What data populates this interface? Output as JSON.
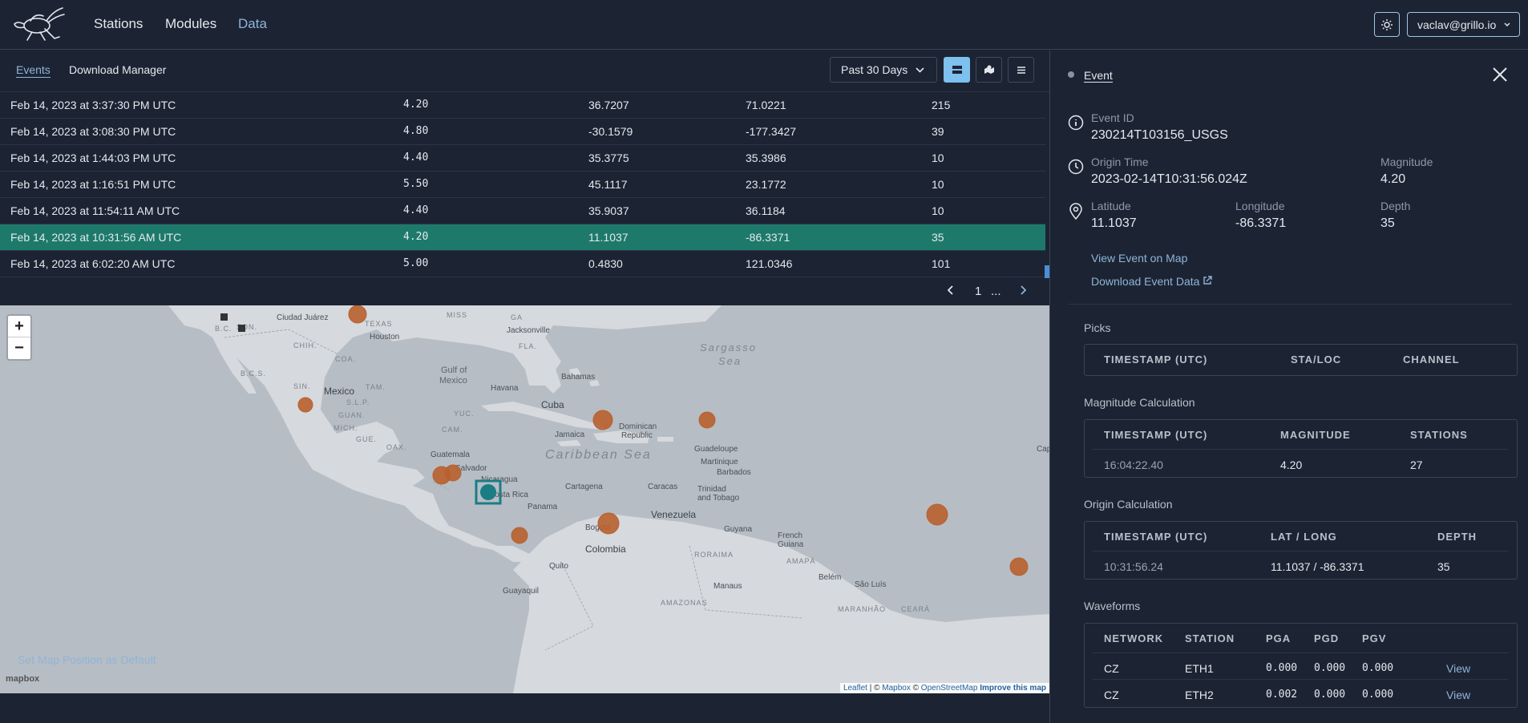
{
  "nav": {
    "items": [
      "Stations",
      "Modules",
      "Data"
    ],
    "active": "Data",
    "user": "vaclav@grillo.io"
  },
  "tabs": [
    "Events",
    "Download Manager"
  ],
  "period_select": "Past 30 Days",
  "events": [
    {
      "time": "Feb 14, 2023 at 3:37:30 PM UTC",
      "mag": "4.20",
      "lat": "36.7207",
      "lon": "71.0221",
      "depth": "215"
    },
    {
      "time": "Feb 14, 2023 at 3:08:30 PM UTC",
      "mag": "4.80",
      "lat": "-30.1579",
      "lon": "-177.3427",
      "depth": "39"
    },
    {
      "time": "Feb 14, 2023 at 1:44:03 PM UTC",
      "mag": "4.40",
      "lat": "35.3775",
      "lon": "35.3986",
      "depth": "10"
    },
    {
      "time": "Feb 14, 2023 at 1:16:51 PM UTC",
      "mag": "5.50",
      "lat": "45.1117",
      "lon": "23.1772",
      "depth": "10"
    },
    {
      "time": "Feb 14, 2023 at 11:54:11 AM UTC",
      "mag": "4.40",
      "lat": "35.9037",
      "lon": "36.1184",
      "depth": "10"
    },
    {
      "time": "Feb 14, 2023 at 10:31:56 AM UTC",
      "mag": "4.20",
      "lat": "11.1037",
      "lon": "-86.3371",
      "depth": "35"
    },
    {
      "time": "Feb 14, 2023 at 6:02:20 AM UTC",
      "mag": "5.00",
      "lat": "0.4830",
      "lon": "121.0346",
      "depth": "101"
    }
  ],
  "pager": {
    "page": "1",
    "ellipsis": "..."
  },
  "map": {
    "labels": {
      "ciudad_juarez": "Ciudad Juárez",
      "texas": "TEXAS",
      "miss": "MISS",
      "ga": "GA",
      "jacksonville": "Jacksonville",
      "fla": "FLA.",
      "houston": "Houston",
      "son": "SON.",
      "chih": "CHIH.",
      "coa": "COA.",
      "bcs": "B.C.S.",
      "bc": "B.C.",
      "sin": "SIN.",
      "tam": "TAM.",
      "mexico": "Mexico",
      "slp": "S.L.P.",
      "guan": "GUAN.",
      "mich": "MICH.",
      "gue": "GUE.",
      "oax": "OAX.",
      "yuc": "YUC.",
      "cam": "CAM.",
      "gulf": "Gulf of",
      "gulf2": "Mexico",
      "havana": "Havana",
      "cuba": "Cuba",
      "bahamas": "Bahamas",
      "sargasso": "Sargasso",
      "sea": "Sea",
      "jamaica": "Jamaica",
      "dominican": "Dominican",
      "republic": "Republic",
      "guatemala": "Guatemala",
      "salvador": "Salvador",
      "nicaragua": "Nicaragua",
      "costa_rica": "Costa Rica",
      "caribbean": "Caribbean Sea",
      "guadeloupe": "Guadeloupe",
      "martinique": "Martinique",
      "barbados": "Barbados",
      "cartagena": "Cartagena",
      "caracas": "Caracas",
      "trinidad": "Trinidad",
      "tobago": "and Tobago",
      "panama": "Panama",
      "venezuela": "Venezuela",
      "bogota": "Bogotá",
      "colombia": "Colombia",
      "guyana": "Guyana",
      "french": "French",
      "guiana": "Guiana",
      "roraima": "RORAIMA",
      "amapa": "AMAPÁ",
      "quito": "Quito",
      "belem": "Belém",
      "sao_luis": "São Luís",
      "manaus": "Manaus",
      "amazonas": "AMAZONAS",
      "guayaquil": "Guayaquil",
      "maranhao": "MARANHÃO",
      "ceara": "CEARÁ",
      "cap": "Cap"
    },
    "zoom_in": "+",
    "zoom_out": "−",
    "mapbox_logo": "mapbox",
    "attribution": {
      "leaflet": "Leaflet",
      "sep1": " | © ",
      "mapbox": "Mapbox",
      "sep2": " © ",
      "osm": "OpenStreetMap",
      "improve": "Improve this map"
    },
    "set_default": "Set Map Position as Default"
  },
  "detail": {
    "tab": "Event",
    "event_id_label": "Event ID",
    "event_id": "230214T103156_USGS",
    "origin_label": "Origin Time",
    "origin": "2023-02-14T10:31:56.024Z",
    "magnitude_label": "Magnitude",
    "magnitude": "4.20",
    "lat_label": "Latitude",
    "lat": "11.1037",
    "lon_label": "Longitude",
    "lon": "-86.3371",
    "depth_label": "Depth",
    "depth": "35",
    "view_on_map": "View Event on Map",
    "download": "Download Event Data",
    "picks_title": "Picks",
    "picks_headers": [
      "TIMESTAMP (UTC)",
      "STA/LOC",
      "CHANNEL"
    ],
    "mag_title": "Magnitude Calculation",
    "mag_headers": [
      "TIMESTAMP (UTC)",
      "MAGNITUDE",
      "STATIONS"
    ],
    "mag_row": [
      "16:04:22.40",
      "4.20",
      "27"
    ],
    "origin_title": "Origin Calculation",
    "origin_headers": [
      "TIMESTAMP (UTC)",
      "LAT / LONG",
      "DEPTH"
    ],
    "origin_row": [
      "10:31:56.24",
      "11.1037 / -86.3371",
      "35"
    ],
    "wave_title": "Waveforms",
    "wave_headers": [
      "NETWORK",
      "STATION",
      "PGA",
      "PGD",
      "PGV"
    ],
    "wave_rows": [
      [
        "CZ",
        "ETH1",
        "0.000",
        "0.000",
        "0.000",
        "View"
      ],
      [
        "CZ",
        "ETH2",
        "0.002",
        "0.000",
        "0.000",
        "View"
      ]
    ]
  },
  "colors": {
    "bg": "#1c2433",
    "accent": "#8fb4d8",
    "selected_row": "#1d7a6b",
    "event_marker": "#b8602e",
    "selected_marker": "#1a7d86"
  }
}
